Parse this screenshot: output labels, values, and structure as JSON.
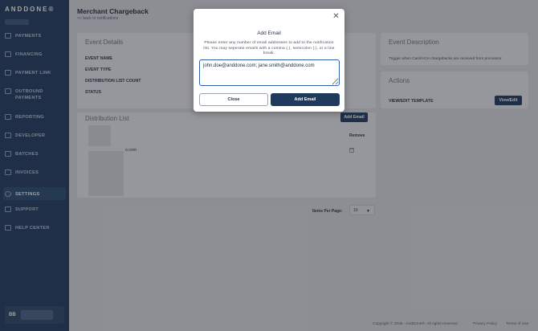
{
  "brand": {
    "logo": "ANDDONE®"
  },
  "sidebar": {
    "items": [
      {
        "label": "PAYMENTS",
        "icon": "payments-icon"
      },
      {
        "label": "FINANCING",
        "icon": "financing-icon"
      },
      {
        "label": "PAYMENT LINK",
        "icon": "payment-link-icon"
      },
      {
        "label": "OUTBOUND PAYMENTS",
        "icon": "outbound-payments-icon"
      },
      {
        "label": "REPORTING",
        "icon": "reporting-icon"
      },
      {
        "label": "DEVELOPER",
        "icon": "developer-icon"
      },
      {
        "label": "BATCHES",
        "icon": "batches-icon"
      },
      {
        "label": "INVOICES",
        "icon": "invoices-icon"
      },
      {
        "label": "SETTINGS",
        "icon": "settings-icon"
      },
      {
        "label": "SUPPORT",
        "icon": "support-icon"
      },
      {
        "label": "HELP CENTER",
        "icon": "help-center-icon"
      }
    ],
    "user_initials": "BB"
  },
  "header": {
    "title": "Merchant Chargeback",
    "back_link": "<< back to notifications"
  },
  "event_details": {
    "title": "Event Details",
    "fields": [
      "EVENT NAME",
      "EVENT TYPE",
      "DISTRIBUTION LIST COUNT",
      "STATUS"
    ]
  },
  "event_description": {
    "title": "Event Description",
    "text": "Trigger when Card/ACH chargebacks are received from processor"
  },
  "actions": {
    "title": "Actions",
    "view_edit_label": "VIEW/EDIT TEMPLATE",
    "view_edit_button": "View/Edit"
  },
  "distribution_list": {
    "title": "Distribution List",
    "add_email_button": "Add Email",
    "remove_header": "Remove",
    "row_text": "o.com"
  },
  "pagination": {
    "items_per_page_label": "Items Per Page:",
    "items_per_page_value": "10"
  },
  "footer": {
    "copyright": "Copyright © 2025 - AndDone®. All rights reserved",
    "privacy": "Privacy Policy",
    "terms": "Terms of Use"
  },
  "modal": {
    "title": "Add Email",
    "description": "Please enter any number of email addresses to add to the notification list. You may seperate emails with a comma (,), semicolon (;), or a line break.",
    "input_value": "john.doe@anddone.com; jane.smith@anddone.com",
    "close_label": "Close",
    "add_label": "Add Email"
  }
}
